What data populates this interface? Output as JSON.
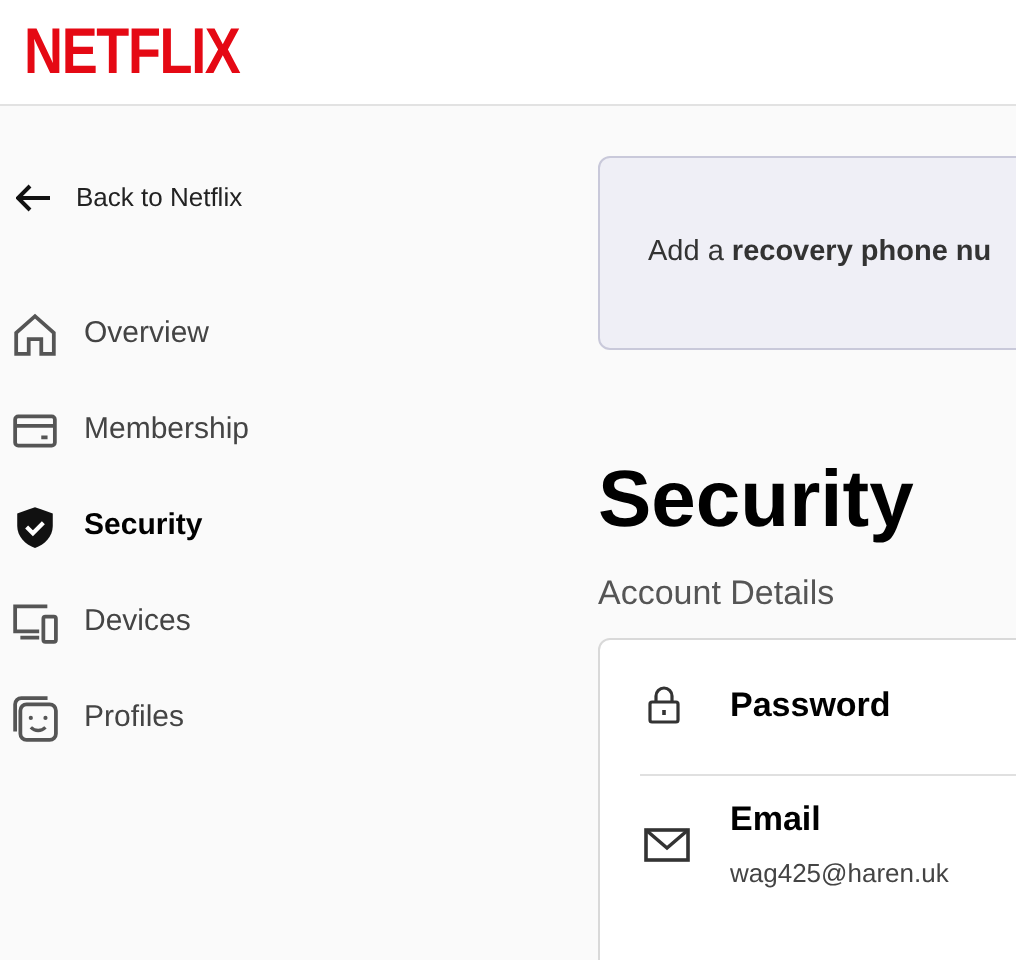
{
  "header": {
    "logo": "NETFLIX"
  },
  "back_link": "Back to Netflix",
  "sidebar": {
    "items": [
      {
        "label": "Overview",
        "selected": false
      },
      {
        "label": "Membership",
        "selected": false
      },
      {
        "label": "Security",
        "selected": true
      },
      {
        "label": "Devices",
        "selected": false
      },
      {
        "label": "Profiles",
        "selected": false
      }
    ]
  },
  "banner": {
    "text": "Add a **recovery phone nu**"
  },
  "page_title": "Security",
  "section_title": "Account Details",
  "account_rows": [
    {
      "title": "Password"
    },
    {
      "title": "Email",
      "value": "wag425@haren.uk"
    }
  ]
}
